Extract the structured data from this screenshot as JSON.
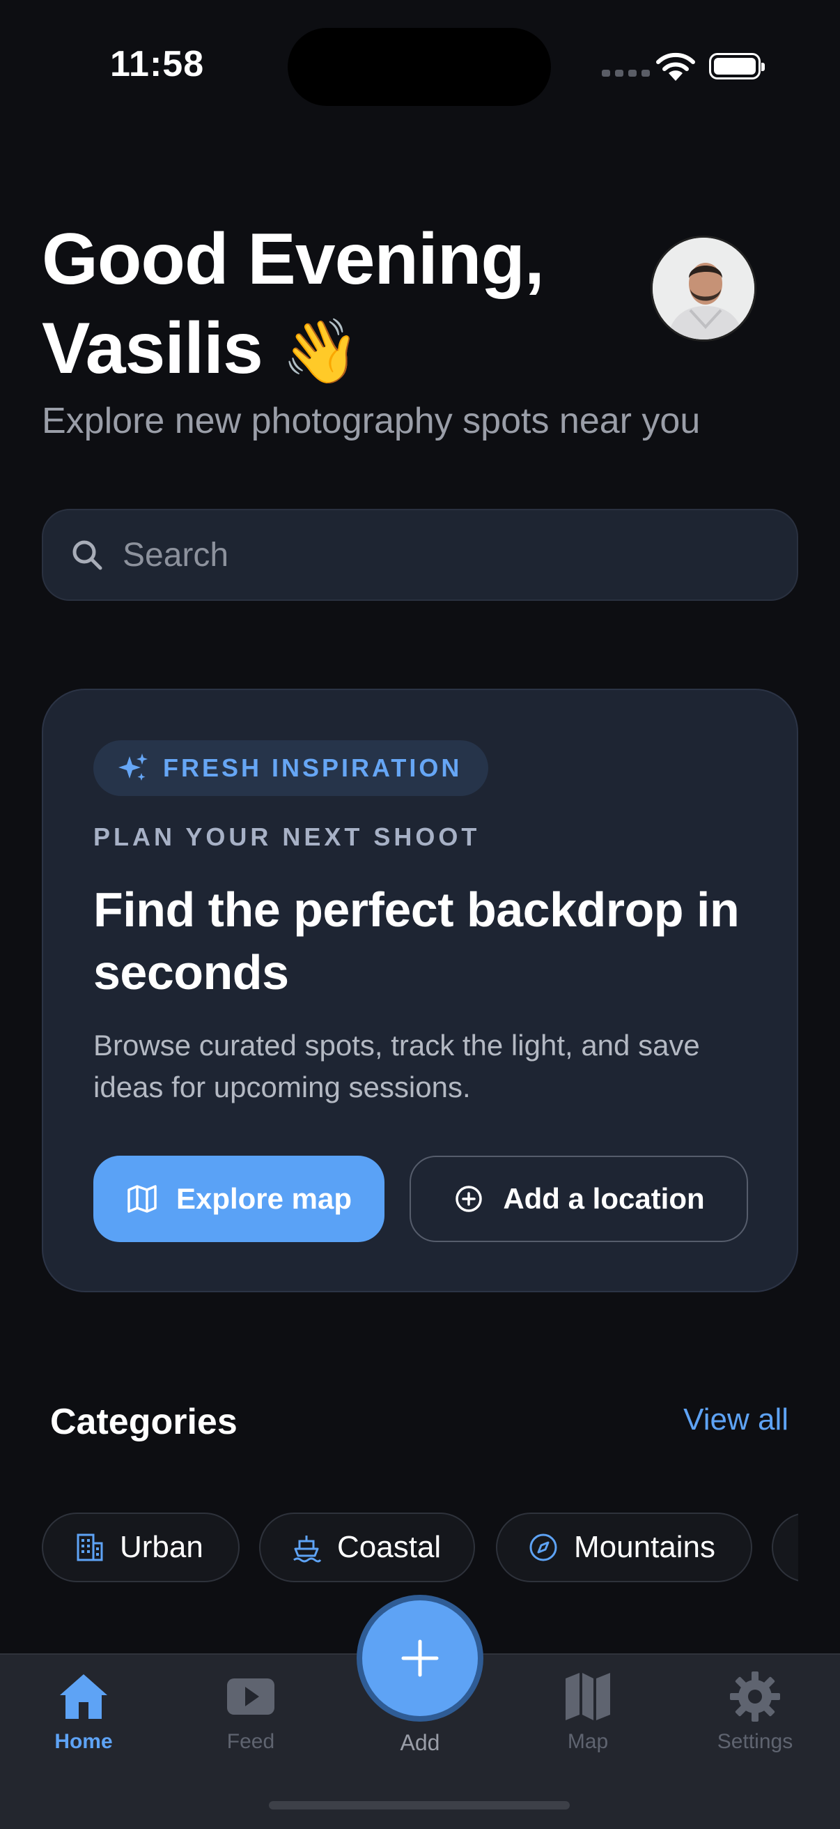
{
  "status_bar": {
    "time": "11:58"
  },
  "header": {
    "greeting_line1": "Good Evening,",
    "greeting_line2": "Vasilis",
    "greeting_emoji": "👋",
    "subtitle": "Explore new photography spots near you"
  },
  "search": {
    "placeholder": "Search",
    "icon": "search-icon"
  },
  "hero": {
    "badge": "FRESH INSPIRATION",
    "badge_icon": "sparkles-icon",
    "eyebrow": "PLAN YOUR NEXT SHOOT",
    "title": "Find the perfect backdrop in seconds",
    "body": "Browse curated spots, track the light, and save ideas for upcoming sessions.",
    "primary_button": {
      "label": "Explore map",
      "icon": "map-icon"
    },
    "secondary_button": {
      "label": "Add a location",
      "icon": "plus-circle-icon"
    }
  },
  "categories": {
    "title": "Categories",
    "view_all": "View all",
    "items": [
      {
        "label": "Urban",
        "icon": "building-icon"
      },
      {
        "label": "Coastal",
        "icon": "boat-icon"
      },
      {
        "label": "Mountains",
        "icon": "compass-icon"
      }
    ]
  },
  "tabbar": {
    "items": [
      {
        "label": "Home",
        "icon": "home-icon",
        "active": true
      },
      {
        "label": "Feed",
        "icon": "play-icon",
        "active": false
      },
      {
        "label": "Add",
        "icon": "plus-icon",
        "active": false
      },
      {
        "label": "Map",
        "icon": "map-icon",
        "active": false
      },
      {
        "label": "Settings",
        "icon": "gear-icon",
        "active": false
      }
    ]
  },
  "colors": {
    "background": "#0d0e12",
    "card": "#1e2533",
    "accent": "#5ea3f5",
    "muted_text": "#9a9ea8"
  }
}
